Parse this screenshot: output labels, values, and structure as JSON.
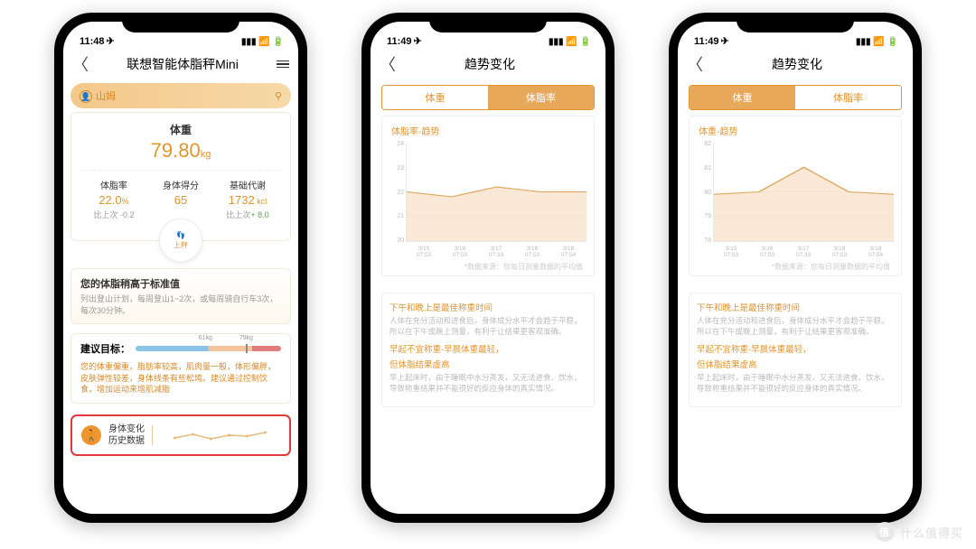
{
  "statusbar": {
    "time1": "11:48",
    "time2": "11:49",
    "time3": "11:49",
    "loc_arrow": "➤"
  },
  "phone1": {
    "title": "联想智能体脂秤Mini",
    "user": "山姆",
    "weight_label": "体重",
    "weight_value": "79.80",
    "weight_unit": "kg",
    "metrics": [
      {
        "label": "体脂率",
        "value": "22.0",
        "unit": "%",
        "diff_label": "比上次",
        "diff": "-0.2",
        "diff_class": ""
      },
      {
        "label": "身体得分",
        "value": "65",
        "unit": "",
        "diff_label": "",
        "diff": "",
        "diff_class": ""
      },
      {
        "label": "基础代谢",
        "value": "1732",
        "unit": " kcl",
        "diff_label": "比上次",
        "diff": "+ 8.0",
        "diff_class": "green"
      }
    ],
    "feet_label": "上秤",
    "tip_title": "您的体脂稍高于标准值",
    "tip_body": "列出登山计划，每周登山1~2次，或每周骑自行车3次，每次30分钟。",
    "goal_label": "建议目标：",
    "goal_tick1": "61kg",
    "goal_tick2": "79kg",
    "goal_desc": "您的体重偏重，脂肪率较高，肌肉量一般，体形偏胖，皮肤弹性较差，身体线条有些松垮。建议通过控制饮食，增加运动来增肌减脂",
    "bottom_line1": "身体变化",
    "bottom_line2": "历史数据"
  },
  "trend": {
    "title": "趋势变化",
    "tab_weight": "体重",
    "tab_fat": "体脂率",
    "note": "*数据来源：您每日测量数据的平均值",
    "advice_h1": "下午和晚上是最佳称重时间",
    "advice_p1": "人体在充分活动和进食后，身体成分水平才会趋于平稳，所以在下午或晚上测量，有利于让结果更客观准确。",
    "advice_h2a": "早起不宜称重-早晨体重最轻，",
    "advice_h2b": "但体脂结果虚高",
    "advice_p2": "早上起床时，由于睡眠中水分蒸发，又无法进食、饮水，导致称重结果并不能很好的反应身体的真实情况。"
  },
  "chart_data": [
    {
      "type": "area",
      "title": "体脂率-趋势",
      "categories": [
        "3/15 07:53",
        "3/16 07:53",
        "3/17 07:33",
        "3/18 07:53",
        "3/18 07:54"
      ],
      "values": [
        22.0,
        21.8,
        22.2,
        22.0,
        22.0
      ],
      "ylim": [
        20,
        24
      ],
      "yticks": [
        20,
        21,
        22,
        23,
        24
      ],
      "xlabel": "",
      "ylabel": ""
    },
    {
      "type": "area",
      "title": "体重-趋势",
      "categories": [
        "3/15 07:53",
        "3/16 07:53",
        "3/17 07:33",
        "3/18 07:53",
        "3/18 07:54"
      ],
      "values": [
        79.9,
        80.0,
        81.0,
        80.0,
        79.9
      ],
      "ylim": [
        78,
        82
      ],
      "yticks": [
        78,
        79,
        80,
        81,
        82
      ],
      "xlabel": "",
      "ylabel": ""
    }
  ],
  "watermark": "什么值得买"
}
